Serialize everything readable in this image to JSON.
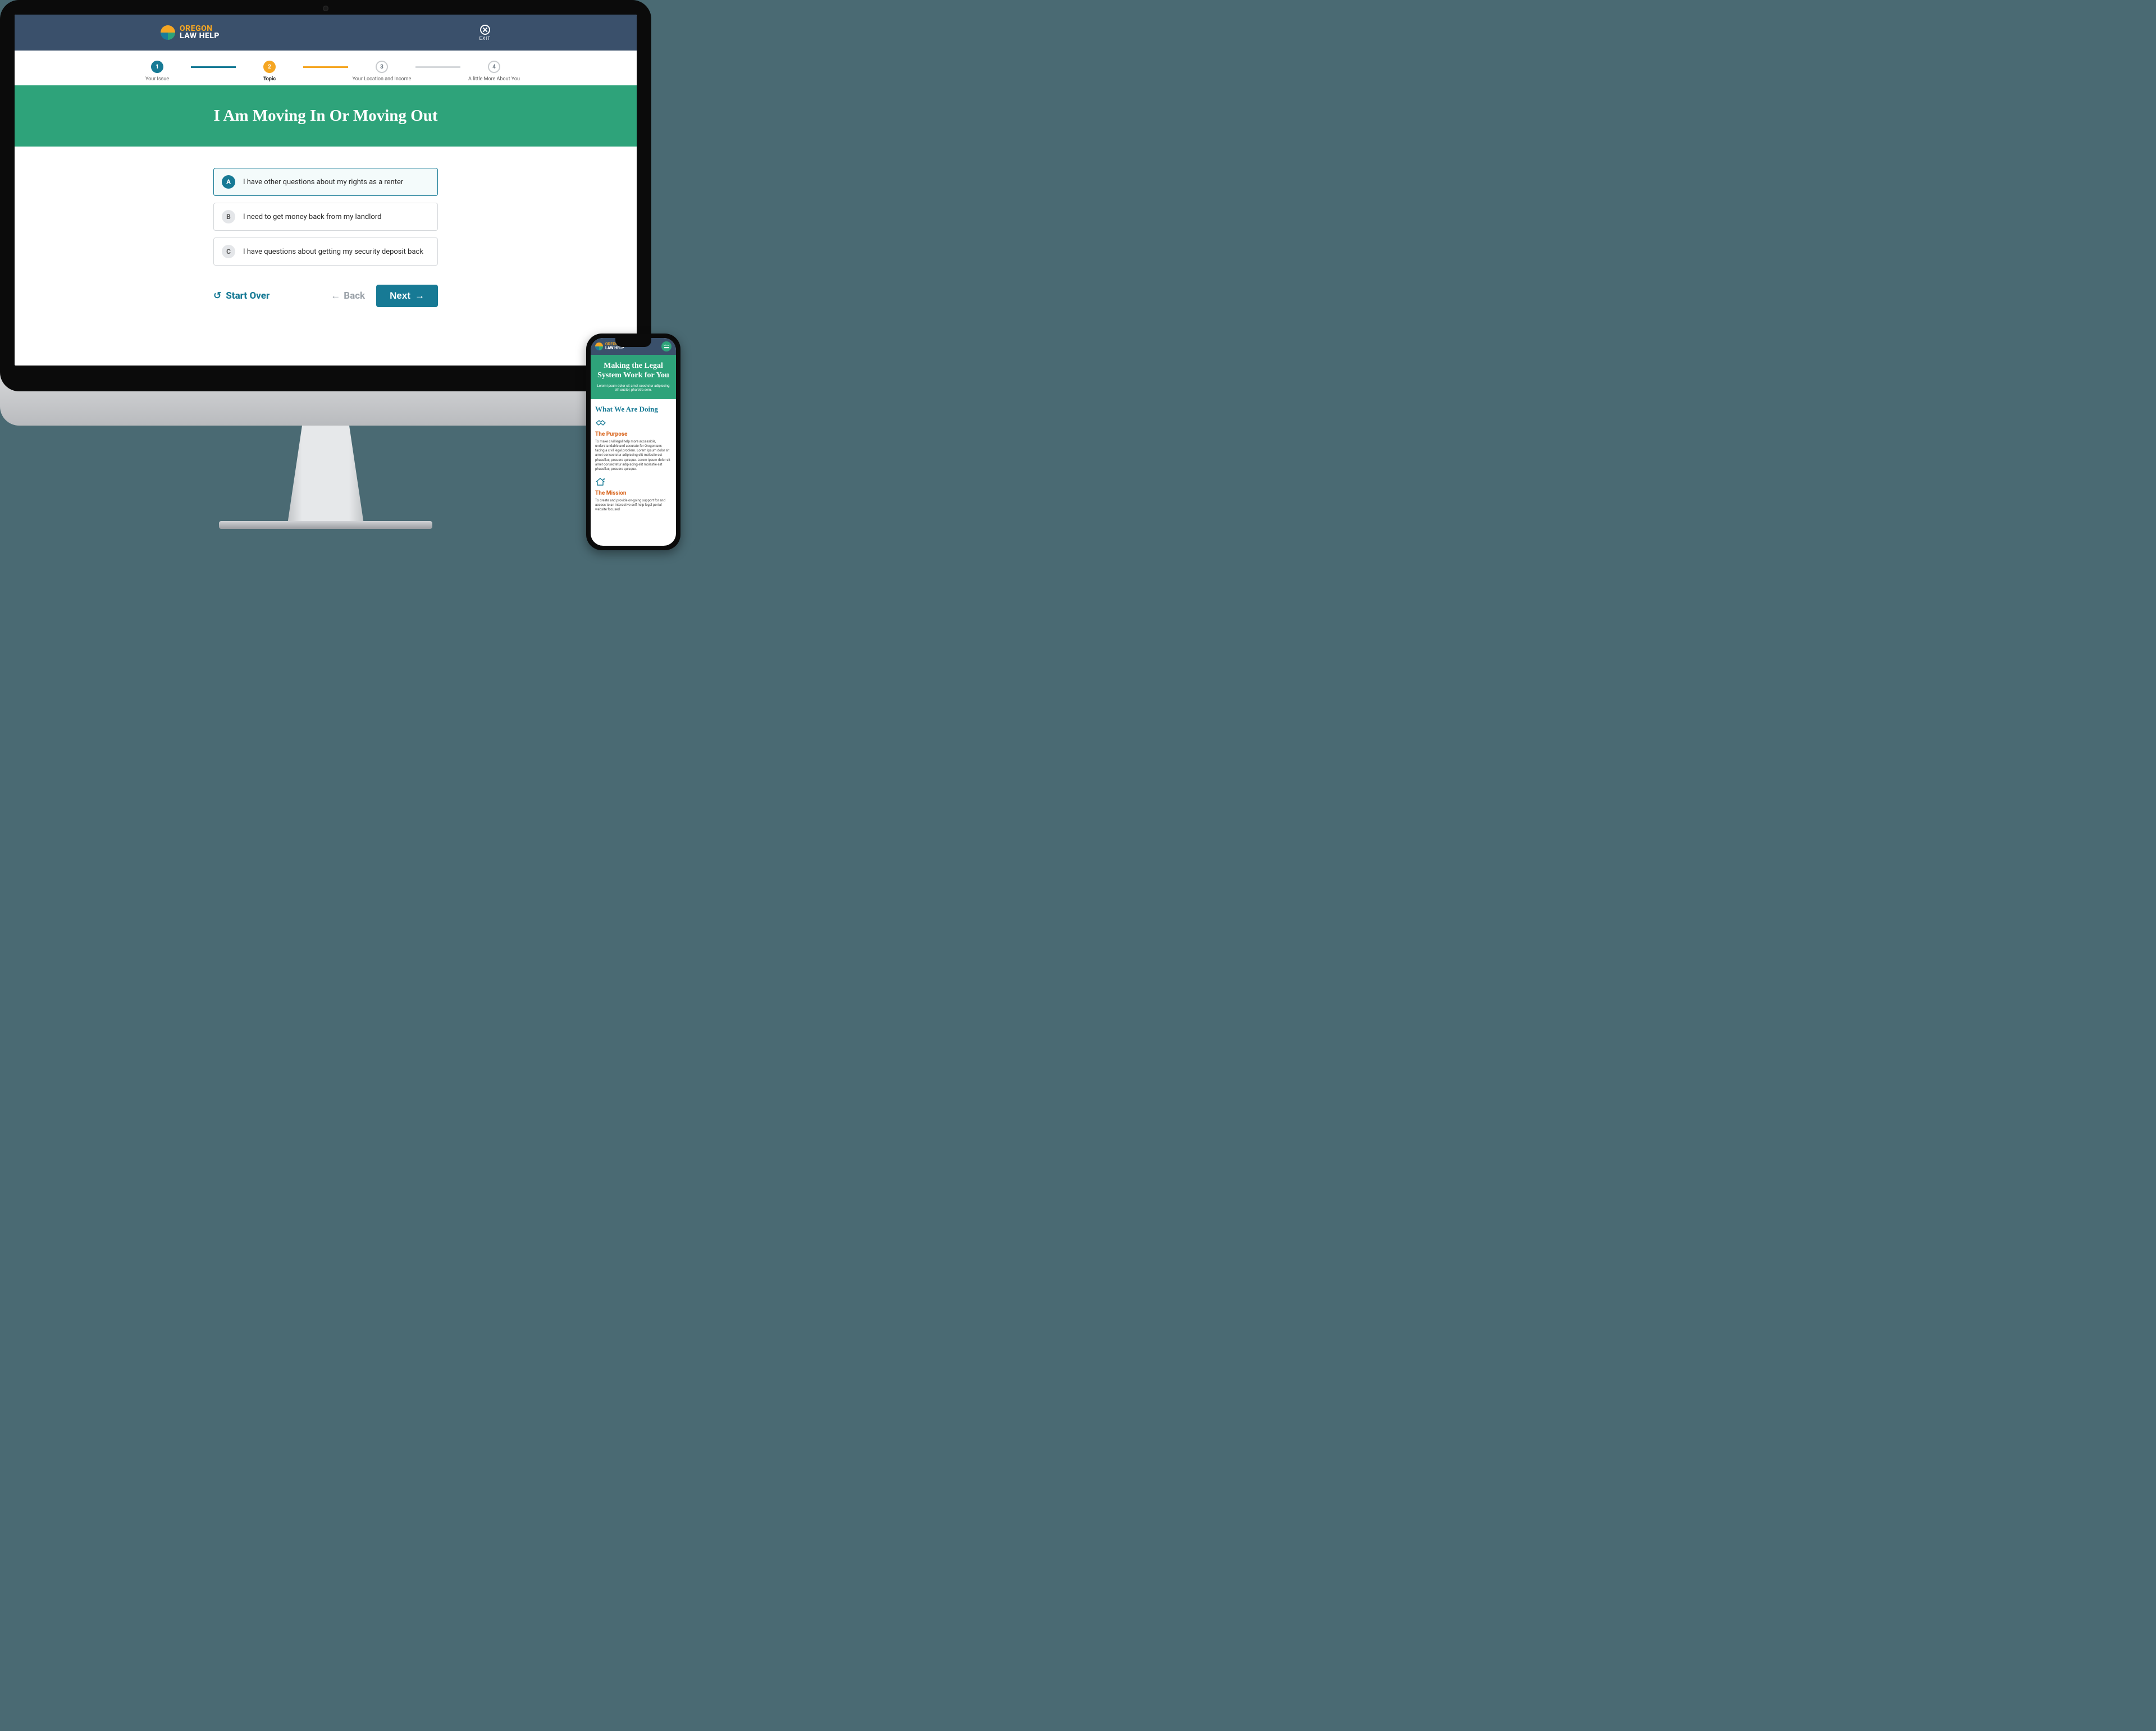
{
  "brand": {
    "line1": "OREGON",
    "line2": "LAW HELP"
  },
  "desktop": {
    "exit_label": "EXIT",
    "steps": [
      {
        "num": "1",
        "label": "Your Issue",
        "state": "done"
      },
      {
        "num": "2",
        "label": "Topic",
        "state": "active"
      },
      {
        "num": "3",
        "label": "Your Location and Income",
        "state": "pending"
      },
      {
        "num": "4",
        "label": "A little More About You",
        "state": "pending"
      }
    ],
    "hero_title": "I Am Moving In Or Moving Out",
    "options": [
      {
        "letter": "A",
        "text": "I have other questions about my rights as a renter",
        "selected": true
      },
      {
        "letter": "B",
        "text": "I need to get money back from my landlord",
        "selected": false
      },
      {
        "letter": "C",
        "text": "I have questions about getting my security deposit back",
        "selected": false
      }
    ],
    "start_over": "Start Over",
    "back": "Back",
    "next": "Next"
  },
  "mobile": {
    "menu_label": "Menu",
    "hero_title": "Making the Legal System Work for You",
    "hero_sub": "Lorem ipsum dolor sit amet coectetur adipiscing elit auctor, pharetra sem.",
    "section_heading": "What We Are Doing",
    "blocks": [
      {
        "title": "The Purpose",
        "body": "To make civil legal help more accessible, understandable and accurate for Oregonians facing a civil legal problem. Lorem ipsum dolor sit amet consectetur adipiscing elit molestie est phasellus, posuere quisque. Lorem ipsum dolor sit amet consectetur adipiscing elit molestie est phasellus, posuere quisque."
      },
      {
        "title": "The Mission",
        "body": "To create and provide on-going support for and access to an interactive self-help legal portal website focused"
      }
    ]
  }
}
